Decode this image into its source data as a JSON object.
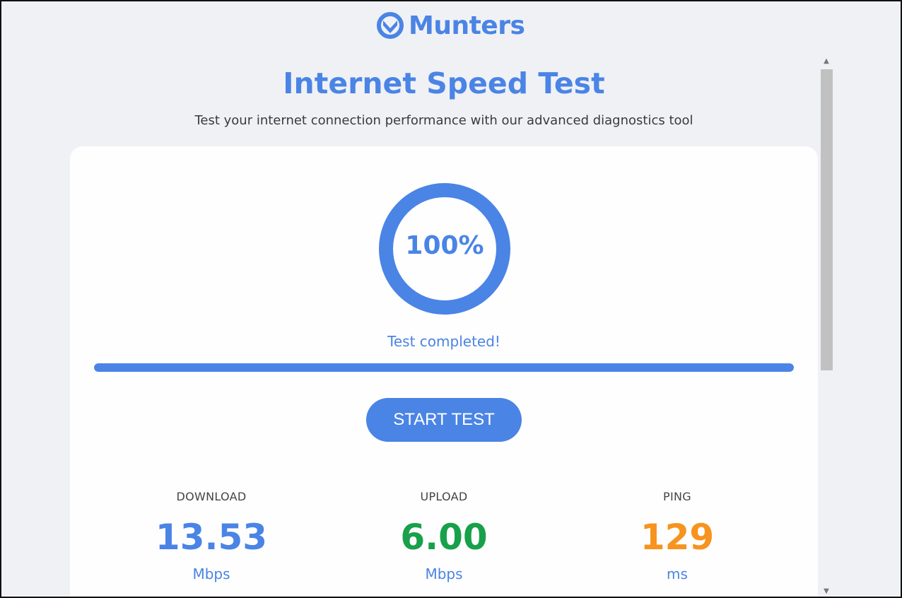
{
  "brand": {
    "name": "Munters",
    "color": "#4a84e5"
  },
  "header": {
    "title": "Internet Speed Test",
    "subtitle": "Test your internet connection performance with our advanced diagnostics tool"
  },
  "gauge": {
    "percent_text": "100%",
    "percent": 100
  },
  "status_text": "Test completed!",
  "progress": {
    "fraction": 1.0
  },
  "start_button_label": "START TEST",
  "results": {
    "download": {
      "label": "DOWNLOAD",
      "value": "13.53",
      "unit": "Mbps",
      "color": "#4a84e5"
    },
    "upload": {
      "label": "UPLOAD",
      "value": "6.00",
      "unit": "Mbps",
      "color": "#18a04a"
    },
    "ping": {
      "label": "PING",
      "value": "129",
      "unit": "ms",
      "color": "#f7931e"
    }
  },
  "icons": {
    "logo": "munters-logo-icon",
    "scroll_up": "scroll-up-arrow-icon",
    "scroll_down": "scroll-down-arrow-icon"
  }
}
